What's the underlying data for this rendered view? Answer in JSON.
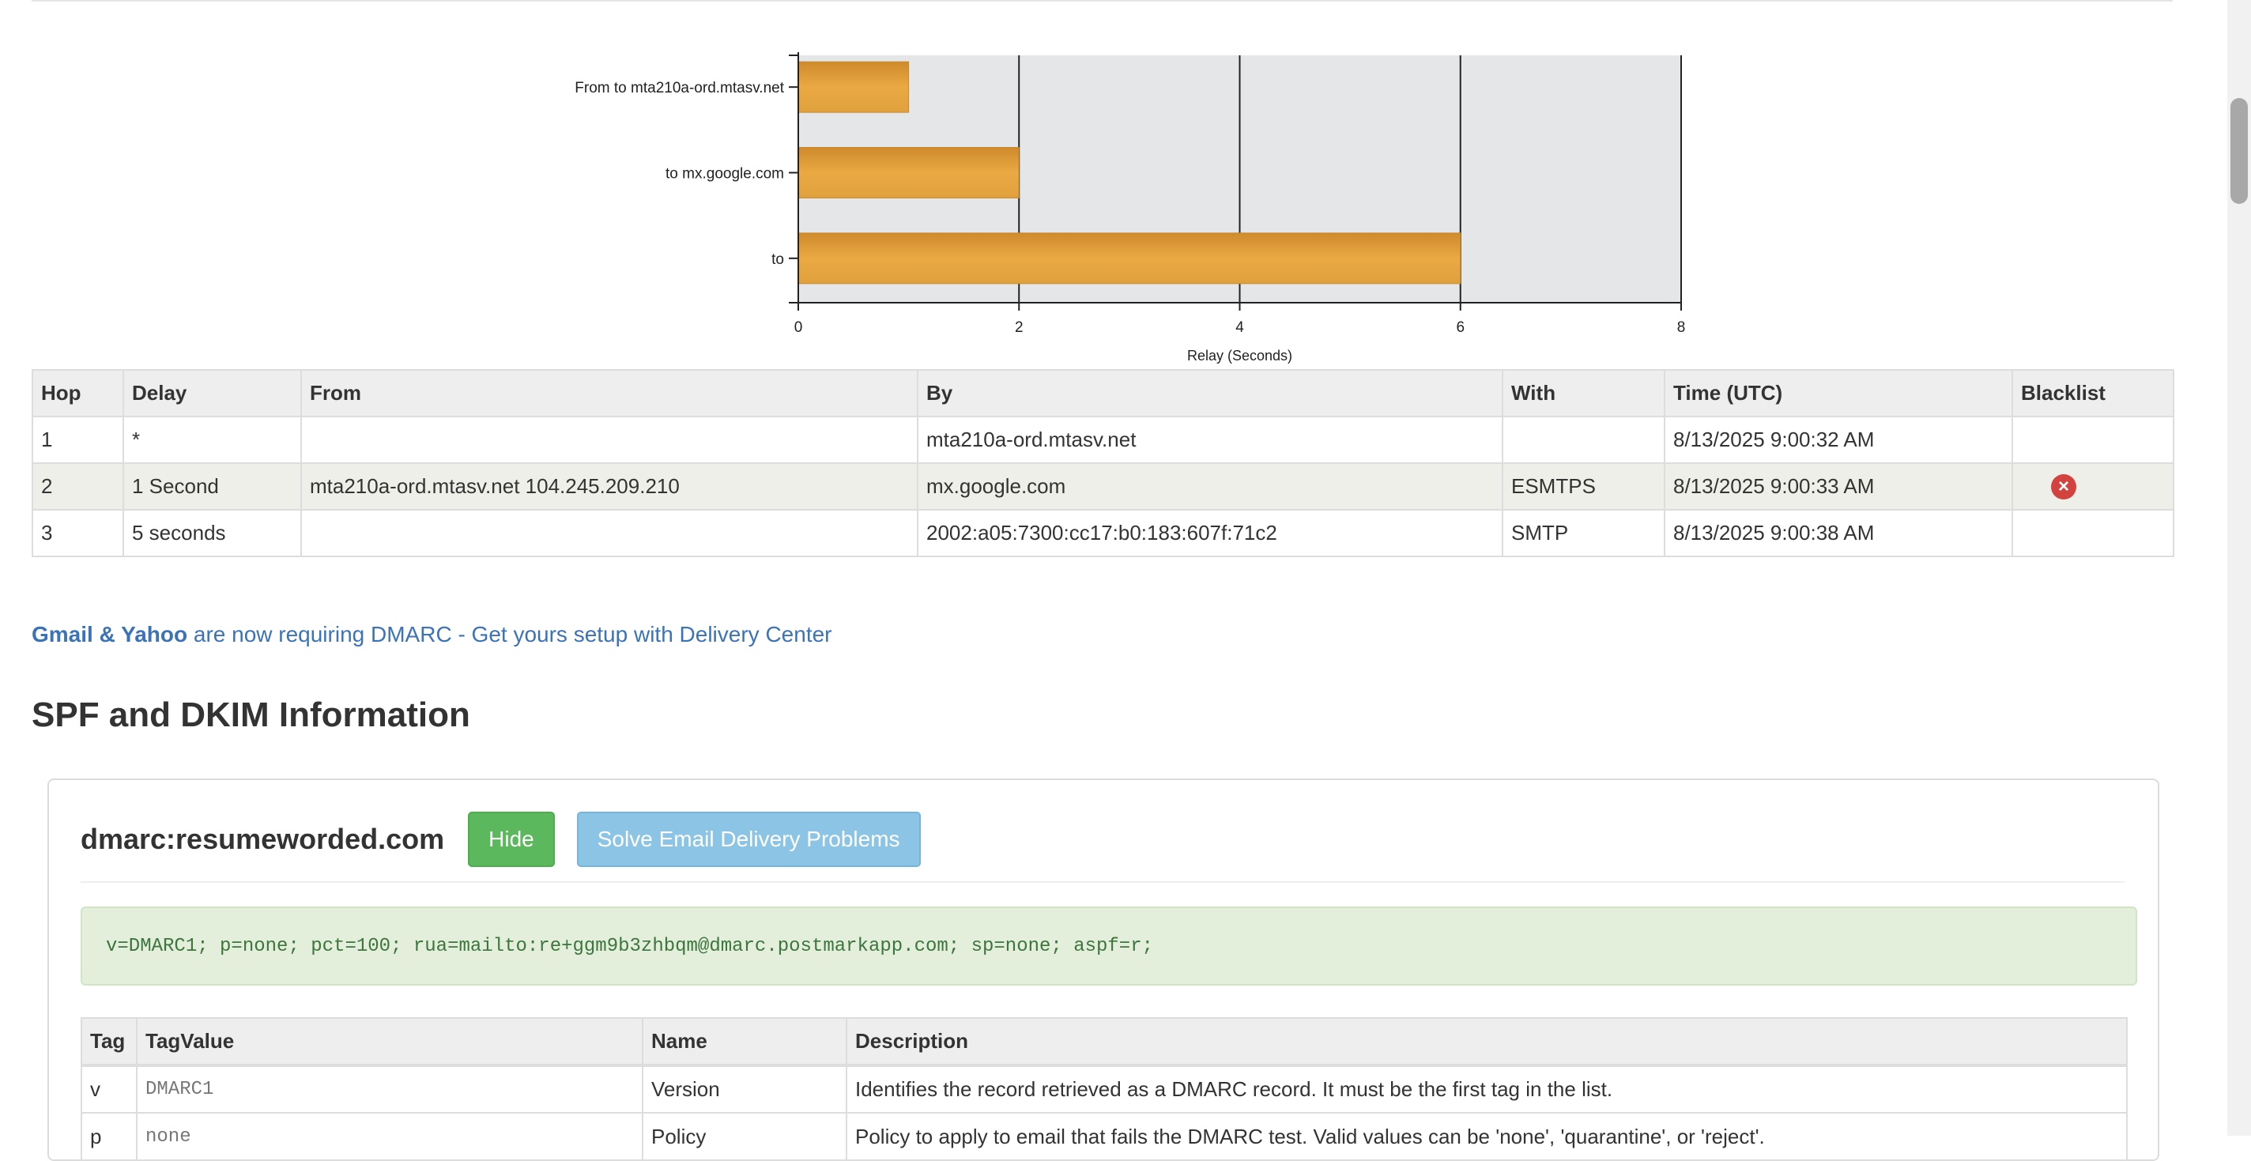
{
  "chart_data": {
    "type": "bar",
    "orientation": "horizontal",
    "categories": [
      "From  to mta210a-ord.mtasv.net",
      "to mx.google.com",
      "to"
    ],
    "values": [
      1,
      2,
      6
    ],
    "xlabel": "Relay (Seconds)",
    "xlim": [
      0,
      8
    ],
    "xticks": [
      0,
      2,
      4,
      6,
      8
    ],
    "grid": true,
    "bar_color": "#e1a13f",
    "bg_color": "#e5e6e8"
  },
  "hops_table": {
    "headers": [
      "Hop",
      "Delay",
      "From",
      "By",
      "With",
      "Time (UTC)",
      "Blacklist"
    ],
    "rows": [
      {
        "hop": "1",
        "delay": "*",
        "from": "",
        "by": "mta210a-ord.mtasv.net",
        "with": "",
        "time": "8/13/2025 9:00:32 AM",
        "blacklist": ""
      },
      {
        "hop": "2",
        "delay": "1 Second",
        "from": "mta210a-ord.mtasv.net 104.245.209.210",
        "by": "mx.google.com",
        "with": "ESMTPS",
        "time": "8/13/2025 9:00:33 AM",
        "blacklist": "x-circle-icon"
      },
      {
        "hop": "3",
        "delay": "5 seconds",
        "from": "",
        "by": "2002:a05:7300:cc17:b0:183:607f:71c2",
        "with": "SMTP",
        "time": "8/13/2025 9:00:38 AM",
        "blacklist": ""
      }
    ]
  },
  "promo": {
    "bold": "Gmail & Yahoo",
    "rest": " are now requiring DMARC - Get yours setup with Delivery Center"
  },
  "section_title": "SPF and DKIM Information",
  "dmarc_panel": {
    "title": "dmarc:resumeworded.com",
    "hide_label": "Hide",
    "solve_label": "Solve Email Delivery Problems",
    "record": "v=DMARC1; p=none; pct=100; rua=mailto:re+ggm9b3zhbqm@dmarc.postmarkapp.com; sp=none; aspf=r;"
  },
  "tags_table": {
    "headers": [
      "Tag",
      "TagValue",
      "Name",
      "Description"
    ],
    "rows": [
      {
        "tag": "v",
        "value": "DMARC1",
        "name": "Version",
        "description": "Identifies the record retrieved as a DMARC record. It must be the first tag in the list."
      },
      {
        "tag": "p",
        "value": "none",
        "name": "Policy",
        "description": "Policy to apply to email that fails the DMARC test. Valid values can be 'none', 'quarantine', or 'reject'."
      }
    ]
  },
  "colors": {
    "link": "#3b73b9",
    "hide_button": "#5cb85c",
    "solve_button": "#8bc4e4",
    "danger": "#d2433f"
  }
}
